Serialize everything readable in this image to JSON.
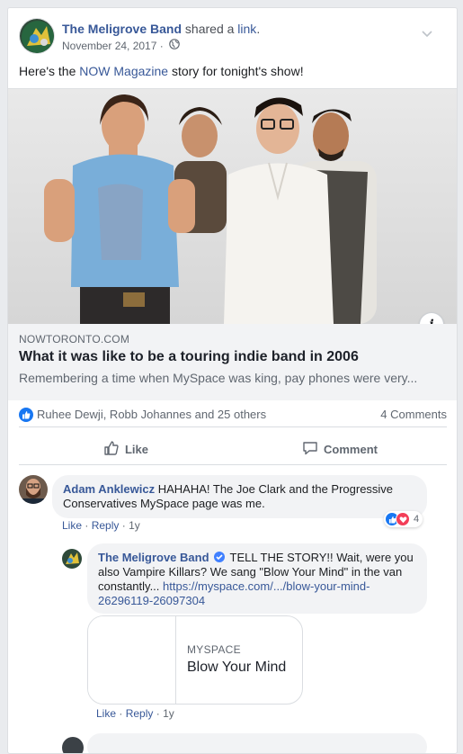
{
  "post": {
    "page_name": "The Meligrove Band",
    "action_text": "shared a",
    "action_link": "link",
    "action_end": ".",
    "date": "November 24, 2017",
    "date_sep": " · ",
    "text_before": "Here's the ",
    "text_link": "NOW Magazine",
    "text_after": " story for tonight's show!"
  },
  "link_preview": {
    "domain": "NOWTORONTO.COM",
    "title": "What it was like to be a touring indie band in 2006",
    "description": "Remembering a time when MySpace was king, pay phones were very...",
    "info_label": "i"
  },
  "reactions": {
    "summary": "Ruhee Dewji, Robb Johannes and 25 others",
    "comments_count": "4 Comments"
  },
  "actions": {
    "like_label": "Like",
    "comment_label": "Comment"
  },
  "comments": [
    {
      "author": "Adam Anklewicz",
      "text": " HAHAHA! The Joe Clark and the Progressive Conservatives MySpace page was me.",
      "like": "Like",
      "reply": "Reply",
      "age": "1y",
      "reaction_count": "4"
    },
    {
      "author": "The Meligrove Band",
      "text": " TELL THE STORY!! Wait, were you also Vampire Killars? We sang \"Blow Your Mind\" in the van constantly... ",
      "url": "https://myspace.com/.../blow-your-mind-26296119-26097304",
      "like": "Like",
      "reply": "Reply",
      "age": "1y",
      "share": {
        "domain": "MYSPACE",
        "title": "Blow Your Mind"
      }
    }
  ],
  "colors": {
    "link": "#385898",
    "like_blue": "#1877f2",
    "love_red": "#f33e58"
  }
}
